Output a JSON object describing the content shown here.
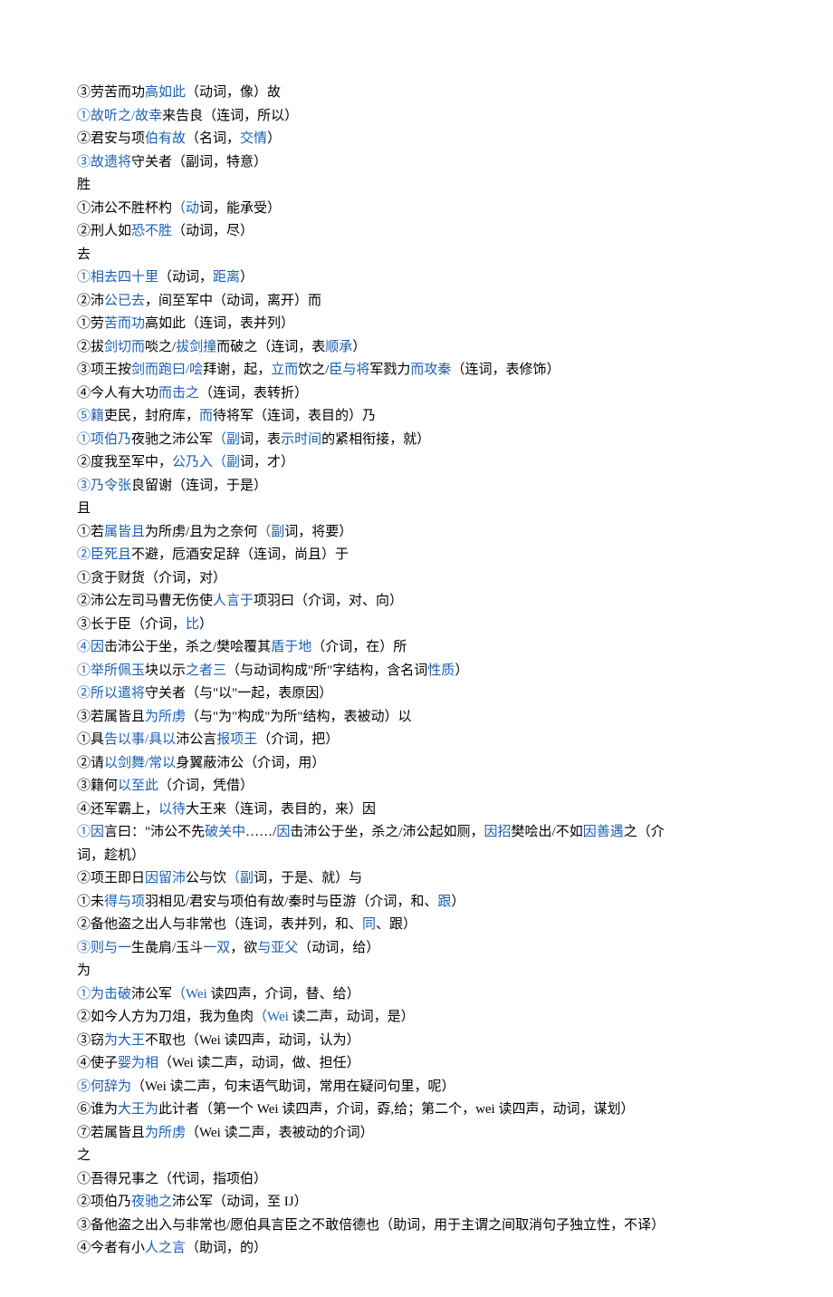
{
  "lines": [
    {
      "segments": [
        {
          "t": "③劳苦而功",
          "c": "p"
        },
        {
          "t": "高如此",
          "c": "b"
        },
        {
          "t": "（动词，像）故",
          "c": "p"
        }
      ]
    },
    {
      "segments": [
        {
          "t": "①故听之/故幸",
          "c": "b"
        },
        {
          "t": "来告良（连词，所以）",
          "c": "p"
        }
      ]
    },
    {
      "segments": [
        {
          "t": "②君安与项",
          "c": "p"
        },
        {
          "t": "伯有故",
          "c": "b"
        },
        {
          "t": "（名词，",
          "c": "p"
        },
        {
          "t": "交情",
          "c": "b"
        },
        {
          "t": "）",
          "c": "p"
        }
      ]
    },
    {
      "segments": [
        {
          "t": "③故遗将",
          "c": "b"
        },
        {
          "t": "守关者（副词，特意）",
          "c": "p"
        }
      ]
    },
    {
      "segments": [
        {
          "t": "胜",
          "c": "p"
        }
      ]
    },
    {
      "segments": [
        {
          "t": "①沛公不胜杯杓",
          "c": "p"
        },
        {
          "t": "（动",
          "c": "b"
        },
        {
          "t": "词，能承受）",
          "c": "p"
        }
      ]
    },
    {
      "segments": [
        {
          "t": "②刑人如",
          "c": "p"
        },
        {
          "t": "恐不胜",
          "c": "b"
        },
        {
          "t": "（动词，尽）",
          "c": "p"
        }
      ]
    },
    {
      "segments": [
        {
          "t": "去",
          "c": "p"
        }
      ]
    },
    {
      "segments": [
        {
          "t": "①相去四十里",
          "c": "b"
        },
        {
          "t": "（动词，",
          "c": "p"
        },
        {
          "t": "距离",
          "c": "b"
        },
        {
          "t": "）",
          "c": "p"
        }
      ]
    },
    {
      "segments": [
        {
          "t": "②沛",
          "c": "p"
        },
        {
          "t": "公已去",
          "c": "b"
        },
        {
          "t": "，间至军中（动词，离开）而",
          "c": "p"
        }
      ]
    },
    {
      "segments": [
        {
          "t": "①劳",
          "c": "p"
        },
        {
          "t": "苦而功",
          "c": "b"
        },
        {
          "t": "高如此（连词，表并列）",
          "c": "p"
        }
      ]
    },
    {
      "segments": [
        {
          "t": "②拔",
          "c": "p"
        },
        {
          "t": "剑切而",
          "c": "b"
        },
        {
          "t": "啖之/",
          "c": "p"
        },
        {
          "t": "拔剑撞",
          "c": "b"
        },
        {
          "t": "而破之（连词，表",
          "c": "p"
        },
        {
          "t": "顺承",
          "c": "b"
        },
        {
          "t": "）",
          "c": "p"
        }
      ]
    },
    {
      "segments": [
        {
          "t": "③项王按",
          "c": "p"
        },
        {
          "t": "剑而跑曰/哙",
          "c": "b"
        },
        {
          "t": "拜谢，起，",
          "c": "p"
        },
        {
          "t": "立而",
          "c": "b"
        },
        {
          "t": "饮之/",
          "c": "p"
        },
        {
          "t": "臣与将",
          "c": "b"
        },
        {
          "t": "军戮力",
          "c": "p"
        },
        {
          "t": "而攻秦",
          "c": "b"
        },
        {
          "t": "（连词，表修饰）",
          "c": "p"
        }
      ]
    },
    {
      "segments": [
        {
          "t": "④今人有大功",
          "c": "p"
        },
        {
          "t": "而击之",
          "c": "b"
        },
        {
          "t": "（连词，表转折）",
          "c": "p"
        }
      ]
    },
    {
      "segments": [
        {
          "t": "⑤籍",
          "c": "b"
        },
        {
          "t": "吏民，封府库，",
          "c": "p"
        },
        {
          "t": "而",
          "c": "b"
        },
        {
          "t": "待将军（连词，表目的）乃",
          "c": "p"
        }
      ]
    },
    {
      "segments": [
        {
          "t": "①项伯乃",
          "c": "b"
        },
        {
          "t": "夜驰之沛公军",
          "c": "p"
        },
        {
          "t": "（副",
          "c": "b"
        },
        {
          "t": "词，表",
          "c": "p"
        },
        {
          "t": "示时间",
          "c": "b"
        },
        {
          "t": "的紧相衔接，就）",
          "c": "p"
        }
      ]
    },
    {
      "segments": [
        {
          "t": "②度我至军中，",
          "c": "p"
        },
        {
          "t": "公乃入（副",
          "c": "b"
        },
        {
          "t": "词，才）",
          "c": "p"
        }
      ]
    },
    {
      "segments": [
        {
          "t": "③乃令张",
          "c": "b"
        },
        {
          "t": "良留谢（连词，于是）",
          "c": "p"
        }
      ]
    },
    {
      "segments": [
        {
          "t": "且",
          "c": "p"
        }
      ]
    },
    {
      "segments": [
        {
          "t": "①若",
          "c": "p"
        },
        {
          "t": "属皆且",
          "c": "b"
        },
        {
          "t": "为所虏/且为之奈何",
          "c": "p"
        },
        {
          "t": "（副",
          "c": "b"
        },
        {
          "t": "词，将要）",
          "c": "p"
        }
      ]
    },
    {
      "segments": [
        {
          "t": "②臣死且",
          "c": "b"
        },
        {
          "t": "不避，卮酒安足辞（连词，尚且）于",
          "c": "p"
        }
      ]
    },
    {
      "segments": [
        {
          "t": "①贪于财货（介词，对）",
          "c": "p"
        }
      ]
    },
    {
      "segments": [
        {
          "t": "②沛公左司马曹无伤使",
          "c": "p"
        },
        {
          "t": "人言于",
          "c": "b"
        },
        {
          "t": "项羽曰（介词，对、向）",
          "c": "p"
        }
      ]
    },
    {
      "segments": [
        {
          "t": "③长于臣（介词，",
          "c": "p"
        },
        {
          "t": "比",
          "c": "b"
        },
        {
          "t": "）",
          "c": "p"
        }
      ]
    },
    {
      "segments": [
        {
          "t": "④因",
          "c": "b"
        },
        {
          "t": "击沛公于坐，杀之/樊哙覆其",
          "c": "p"
        },
        {
          "t": "盾于地",
          "c": "b"
        },
        {
          "t": "（介词，在）所",
          "c": "p"
        }
      ]
    },
    {
      "segments": [
        {
          "t": "①举所佩玉",
          "c": "b"
        },
        {
          "t": "块以示",
          "c": "p"
        },
        {
          "t": "之者三",
          "c": "b"
        },
        {
          "t": "（与动词构成\"所\"字结构，含名词",
          "c": "p"
        },
        {
          "t": "性质",
          "c": "b"
        },
        {
          "t": "）",
          "c": "p"
        }
      ]
    },
    {
      "segments": [
        {
          "t": "②所以遣将",
          "c": "b"
        },
        {
          "t": "守关者（与\"以\"一起，表原因）",
          "c": "p"
        }
      ]
    },
    {
      "segments": [
        {
          "t": "③若属皆且",
          "c": "p"
        },
        {
          "t": "为所虏",
          "c": "b"
        },
        {
          "t": "（与\"为\"构成\"为所\"结构，表被动）以",
          "c": "p"
        }
      ]
    },
    {
      "segments": [
        {
          "t": "①具",
          "c": "p"
        },
        {
          "t": "告以事/具以",
          "c": "b"
        },
        {
          "t": "沛公言",
          "c": "p"
        },
        {
          "t": "报项王",
          "c": "b"
        },
        {
          "t": "（介词，把）",
          "c": "p"
        }
      ]
    },
    {
      "segments": [
        {
          "t": "②请",
          "c": "p"
        },
        {
          "t": "以剑舞/常以",
          "c": "b"
        },
        {
          "t": "身翼蔽沛公（介词，用）",
          "c": "p"
        }
      ]
    },
    {
      "segments": [
        {
          "t": "③籍何",
          "c": "p"
        },
        {
          "t": "以至此",
          "c": "b"
        },
        {
          "t": "（介词，凭借）",
          "c": "p"
        }
      ]
    },
    {
      "segments": [
        {
          "t": "④还军霸上，",
          "c": "p"
        },
        {
          "t": "以待",
          "c": "b"
        },
        {
          "t": "大王来（连词，表目的，来）因",
          "c": "p"
        }
      ]
    },
    {
      "segments": [
        {
          "t": "①因",
          "c": "b"
        },
        {
          "t": "言曰：\"沛公不先",
          "c": "p"
        },
        {
          "t": "破关中",
          "c": "b"
        },
        {
          "t": "……/",
          "c": "p"
        },
        {
          "t": "因",
          "c": "b"
        },
        {
          "t": "击沛公于坐，杀之/沛公起如厕，",
          "c": "p"
        },
        {
          "t": "因招",
          "c": "b"
        },
        {
          "t": "樊哙出/不如",
          "c": "p"
        },
        {
          "t": "因善遇",
          "c": "b"
        },
        {
          "t": "之（介",
          "c": "p"
        }
      ]
    },
    {
      "segments": [
        {
          "t": "词，趁机）",
          "c": "p"
        }
      ]
    },
    {
      "segments": [
        {
          "t": "②项王即日",
          "c": "p"
        },
        {
          "t": "因留沛",
          "c": "b"
        },
        {
          "t": "公与饮",
          "c": "p"
        },
        {
          "t": "（副",
          "c": "b"
        },
        {
          "t": "词，于是、就）与",
          "c": "p"
        }
      ]
    },
    {
      "segments": [
        {
          "t": "①未",
          "c": "p"
        },
        {
          "t": "得与项",
          "c": "b"
        },
        {
          "t": "羽相见/君安与项伯有故/秦时与臣游（介词，和、",
          "c": "p"
        },
        {
          "t": "跟",
          "c": "b"
        },
        {
          "t": "）",
          "c": "p"
        }
      ]
    },
    {
      "segments": [
        {
          "t": "②备他盗之出人与非常也（连词，表并列，和、",
          "c": "p"
        },
        {
          "t": "同",
          "c": "b"
        },
        {
          "t": "、跟）",
          "c": "p"
        }
      ]
    },
    {
      "segments": [
        {
          "t": "③则与一",
          "c": "b"
        },
        {
          "t": "生彘肩/玉斗",
          "c": "p"
        },
        {
          "t": "一双",
          "c": "b"
        },
        {
          "t": "，欲",
          "c": "p"
        },
        {
          "t": "与亚父",
          "c": "b"
        },
        {
          "t": "（动词，给）",
          "c": "p"
        }
      ]
    },
    {
      "segments": [
        {
          "t": "为",
          "c": "p"
        }
      ]
    },
    {
      "segments": [
        {
          "t": "①为击破",
          "c": "b"
        },
        {
          "t": "沛公军",
          "c": "p"
        },
        {
          "t": "（Wei",
          "c": "b"
        },
        {
          "t": " 读四声，介词，替、给）",
          "c": "p"
        }
      ]
    },
    {
      "segments": [
        {
          "t": "②如今人方为刀俎，我为鱼肉",
          "c": "p"
        },
        {
          "t": "（Wei",
          "c": "b"
        },
        {
          "t": " 读二声，动词，是）",
          "c": "p"
        }
      ]
    },
    {
      "segments": [
        {
          "t": "③窃",
          "c": "p"
        },
        {
          "t": "为大王",
          "c": "b"
        },
        {
          "t": "不取也（Wei 读四声，动词，认为）",
          "c": "p"
        }
      ]
    },
    {
      "segments": [
        {
          "t": "④使子",
          "c": "p"
        },
        {
          "t": "婴为相",
          "c": "b"
        },
        {
          "t": "（Wei 读二声，动词，做、担任）",
          "c": "p"
        }
      ]
    },
    {
      "segments": [
        {
          "t": "⑤何辞为",
          "c": "b"
        },
        {
          "t": "（Wei 读二声，句末语气助词，常用在疑问句里，呢）",
          "c": "p"
        }
      ]
    },
    {
      "segments": [
        {
          "t": "⑥谁为",
          "c": "p"
        },
        {
          "t": "大王为",
          "c": "b"
        },
        {
          "t": "此计者（第一个 Wei 读四声，介词，孬,给；第二个，wei 读四声，动词，谋划）",
          "c": "p"
        }
      ]
    },
    {
      "segments": [
        {
          "t": "⑦若属皆且",
          "c": "p"
        },
        {
          "t": "为所虏",
          "c": "b"
        },
        {
          "t": "（Wei 读二声，表被动的介词）",
          "c": "p"
        }
      ]
    },
    {
      "segments": [
        {
          "t": "之",
          "c": "p"
        }
      ]
    },
    {
      "segments": [
        {
          "t": "①吾得兄事之（代词，指项伯）",
          "c": "p"
        }
      ]
    },
    {
      "segments": [
        {
          "t": "②项伯乃",
          "c": "p"
        },
        {
          "t": "夜驰之",
          "c": "b"
        },
        {
          "t": "沛公军（动词，至 IJ）",
          "c": "p"
        }
      ]
    },
    {
      "segments": [
        {
          "t": "③备他盗之出入与非常也/愿伯具言臣之不敢倍德也（助词，用于主谓之间取消句子独立性，不译）",
          "c": "p"
        }
      ]
    },
    {
      "segments": [
        {
          "t": "④今者有小",
          "c": "p"
        },
        {
          "t": "人之言",
          "c": "b"
        },
        {
          "t": "（助词，的）",
          "c": "p"
        }
      ]
    }
  ]
}
